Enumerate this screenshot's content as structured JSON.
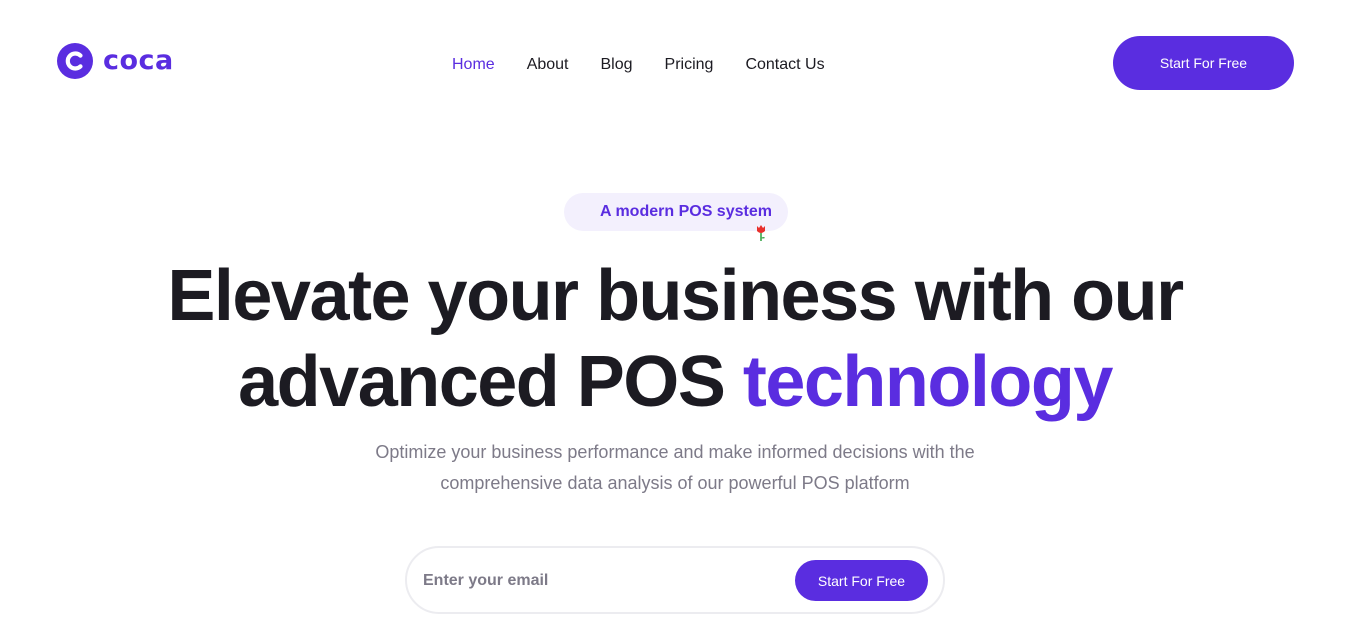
{
  "brand": {
    "name": "coca",
    "icon": "coca-logo-icon",
    "color": "#5a2de0"
  },
  "nav": {
    "items": [
      {
        "label": "Home",
        "active": true
      },
      {
        "label": "About",
        "active": false
      },
      {
        "label": "Blog",
        "active": false
      },
      {
        "label": "Pricing",
        "active": false
      },
      {
        "label": "Contact Us",
        "active": false
      }
    ],
    "cta_label": "Start For Free"
  },
  "hero": {
    "badge": "A modern POS system",
    "badge_icon": "rose-icon",
    "headline_line1": "Elevate your business with our",
    "headline_line2": "advanced POS ",
    "headline_accent": "technology",
    "subtitle_line1": "Optimize your business performance and make informed decisions with the",
    "subtitle_line2": "comprehensive data analysis of our powerful POS platform",
    "email_placeholder": "Enter your email",
    "email_cta_label": "Start For Free"
  },
  "colors": {
    "accent": "#5a2de0",
    "text": "#1c1b22",
    "muted": "#7d7a88",
    "badge_bg": "#f3f0fd"
  }
}
